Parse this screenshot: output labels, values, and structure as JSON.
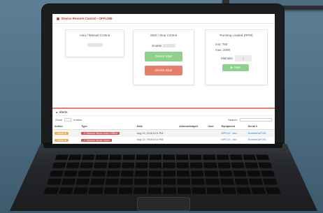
{
  "app": {
    "title": "Device Remote Control - OFFLINE"
  },
  "auto_manual": {
    "title": "Auto / Manual Control"
  },
  "start_stop": {
    "title": "Start / Stop Control",
    "enable_label": "Enable",
    "start_button": "Device Start",
    "stop_button": "Device Stop"
  },
  "running": {
    "title": "Running Loaded (RPM)",
    "min_label": "min: 780",
    "max_label": "max: 2200",
    "maintain_label": "Maintain",
    "maintain_value": "0",
    "start_button": "▶ Start"
  },
  "alerts": {
    "header": "Alerts",
    "show_label": "Show",
    "show_value": "10",
    "entries_label": "entries",
    "search_label": "Search:",
    "columns": [
      "Action",
      "Type",
      "Date",
      "Acknowledged",
      "User",
      "Equipment",
      "Serial #"
    ],
    "rows": [
      {
        "action": "Action ▾",
        "type": "Manual Mode Auto=Offline",
        "date": "Aug 22, 2018 6:01 PM",
        "ack": "",
        "user": "",
        "equipment": "MPC10 - abc",
        "serial": "Ecotek/DaF001"
      },
      {
        "action": "Action ▾",
        "type": "Manual Mode Alarm",
        "date": "Aug 22, 2018 6:04 PM",
        "ack": "",
        "user": "",
        "equipment": "MPC10 - abc",
        "serial": "Ecotek/DaF001"
      },
      {
        "action": "Action ▾",
        "type": "Manual Mode Auto=Offline",
        "date": "Aug 22, 2018 6:51 PM",
        "ack": "",
        "user": "",
        "equipment": "MPC10 - abc",
        "serial": "Ecotek/DaF001"
      }
    ]
  },
  "colors": {
    "brand_red": "#c0392b",
    "start_green": "#8fd18c",
    "stop_red": "#e57d6b",
    "action_orange": "#f0ad4e",
    "badge_red": "#d9534f"
  }
}
